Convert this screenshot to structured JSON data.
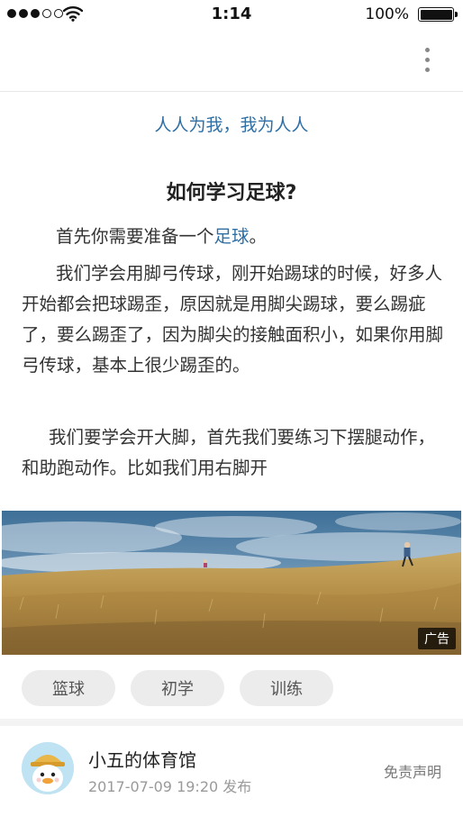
{
  "status_bar": {
    "time": "1:14",
    "battery": "100%",
    "signal_dots_filled": 3,
    "signal_dots_total": 5,
    "wifi_icon": "wifi-icon"
  },
  "nav": {
    "more_icon": "more-vertical-icon"
  },
  "article": {
    "slogan": "人人为我，我为人人",
    "title": "如何学习足球?",
    "p1_prefix": "首先你需要准备一个",
    "p1_keyword": "足球",
    "p1_suffix": "。",
    "p2": "我们学会用脚弓传球，刚开始踢球的时候，好多人开始都会把球踢歪，原因就是用脚尖踢球，要么踢疵了，要么踢歪了，因为脚尖的接触面积小，如果你用脚弓传球，基本上很少踢歪的。",
    "p3": "我们要学会开大脚，首先我们要练习下摆腿动作，和助跑动作。比如我们用右脚开"
  },
  "ad": {
    "label": "广告"
  },
  "tags": [
    "篮球",
    "初学",
    "训练"
  ],
  "author": {
    "name": "小五的体育馆",
    "publish_time": "2017-07-09 19:20 发布",
    "disclaimer": "免责声明"
  },
  "colors": {
    "accent": "#2f6fa6",
    "tag_bg": "#ececec",
    "meta_text": "#9a9a9a"
  }
}
